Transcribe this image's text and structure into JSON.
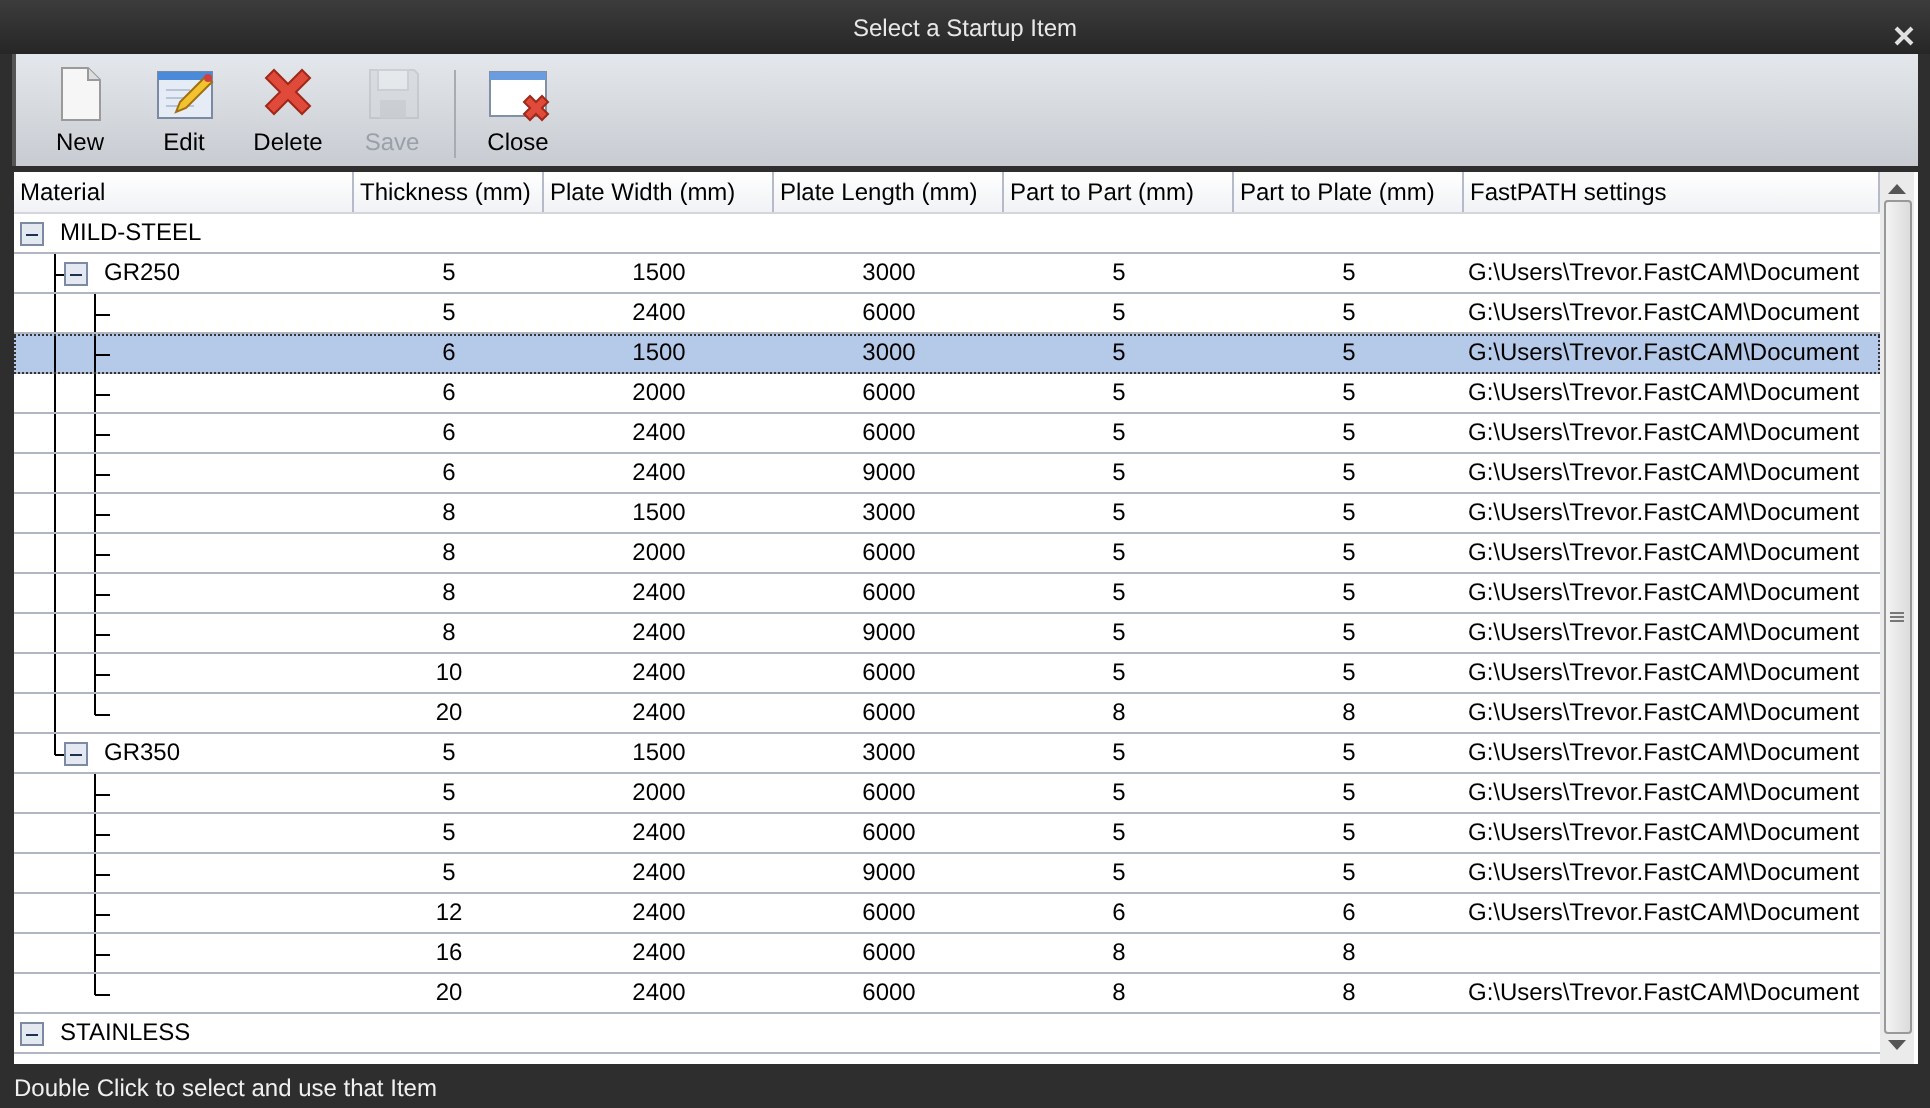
{
  "window": {
    "title": "Select a Startup Item"
  },
  "toolbar": [
    {
      "label": "New",
      "kind": "new",
      "disabled": false,
      "separator_before": false
    },
    {
      "label": "Edit",
      "kind": "edit",
      "disabled": false,
      "separator_before": false
    },
    {
      "label": "Delete",
      "kind": "delete",
      "disabled": false,
      "separator_before": false
    },
    {
      "label": "Save",
      "kind": "save",
      "disabled": true,
      "separator_before": false
    },
    {
      "label": "Close",
      "kind": "close",
      "disabled": false,
      "separator_before": true
    }
  ],
  "columns": [
    "Material",
    "Thickness (mm)",
    "Plate Width (mm)",
    "Plate Length (mm)",
    "Part to Part (mm)",
    "Part to Plate (mm)",
    "FastPATH settings"
  ],
  "tree": [
    {
      "label": "MILD-STEEL",
      "expanded": true,
      "selected": false,
      "children": [
        {
          "label": "GR250",
          "expanded": true,
          "selected": false,
          "cells": [
            "5",
            "1500",
            "3000",
            "5",
            "5",
            "G:\\Users\\Trevor.FastCAM\\Document"
          ],
          "children": [
            {
              "selected": false,
              "cells": [
                "5",
                "2400",
                "6000",
                "5",
                "5",
                "G:\\Users\\Trevor.FastCAM\\Document"
              ]
            },
            {
              "selected": true,
              "cells": [
                "6",
                "1500",
                "3000",
                "5",
                "5",
                "G:\\Users\\Trevor.FastCAM\\Document"
              ]
            },
            {
              "selected": false,
              "cells": [
                "6",
                "2000",
                "6000",
                "5",
                "5",
                "G:\\Users\\Trevor.FastCAM\\Document"
              ]
            },
            {
              "selected": false,
              "cells": [
                "6",
                "2400",
                "6000",
                "5",
                "5",
                "G:\\Users\\Trevor.FastCAM\\Document"
              ]
            },
            {
              "selected": false,
              "cells": [
                "6",
                "2400",
                "9000",
                "5",
                "5",
                "G:\\Users\\Trevor.FastCAM\\Document"
              ]
            },
            {
              "selected": false,
              "cells": [
                "8",
                "1500",
                "3000",
                "5",
                "5",
                "G:\\Users\\Trevor.FastCAM\\Document"
              ]
            },
            {
              "selected": false,
              "cells": [
                "8",
                "2000",
                "6000",
                "5",
                "5",
                "G:\\Users\\Trevor.FastCAM\\Document"
              ]
            },
            {
              "selected": false,
              "cells": [
                "8",
                "2400",
                "6000",
                "5",
                "5",
                "G:\\Users\\Trevor.FastCAM\\Document"
              ]
            },
            {
              "selected": false,
              "cells": [
                "8",
                "2400",
                "9000",
                "5",
                "5",
                "G:\\Users\\Trevor.FastCAM\\Document"
              ]
            },
            {
              "selected": false,
              "cells": [
                "10",
                "2400",
                "6000",
                "5",
                "5",
                "G:\\Users\\Trevor.FastCAM\\Document"
              ]
            },
            {
              "selected": false,
              "cells": [
                "20",
                "2400",
                "6000",
                "8",
                "8",
                "G:\\Users\\Trevor.FastCAM\\Document"
              ]
            }
          ]
        },
        {
          "label": "GR350",
          "expanded": true,
          "selected": false,
          "cells": [
            "5",
            "1500",
            "3000",
            "5",
            "5",
            "G:\\Users\\Trevor.FastCAM\\Document"
          ],
          "children": [
            {
              "selected": false,
              "cells": [
                "5",
                "2000",
                "6000",
                "5",
                "5",
                "G:\\Users\\Trevor.FastCAM\\Document"
              ]
            },
            {
              "selected": false,
              "cells": [
                "5",
                "2400",
                "6000",
                "5",
                "5",
                "G:\\Users\\Trevor.FastCAM\\Document"
              ]
            },
            {
              "selected": false,
              "cells": [
                "5",
                "2400",
                "9000",
                "5",
                "5",
                "G:\\Users\\Trevor.FastCAM\\Document"
              ]
            },
            {
              "selected": false,
              "cells": [
                "12",
                "2400",
                "6000",
                "6",
                "6",
                "G:\\Users\\Trevor.FastCAM\\Document"
              ]
            },
            {
              "selected": false,
              "cells": [
                "16",
                "2400",
                "6000",
                "8",
                "8"
              ]
            },
            {
              "selected": false,
              "cells": [
                "20",
                "2400",
                "6000",
                "8",
                "8",
                "G:\\Users\\Trevor.FastCAM\\Document"
              ]
            }
          ]
        }
      ]
    },
    {
      "label": "STAINLESS",
      "expanded": true,
      "selected": false
    }
  ],
  "status_bar": "Double Click to select and use that Item"
}
